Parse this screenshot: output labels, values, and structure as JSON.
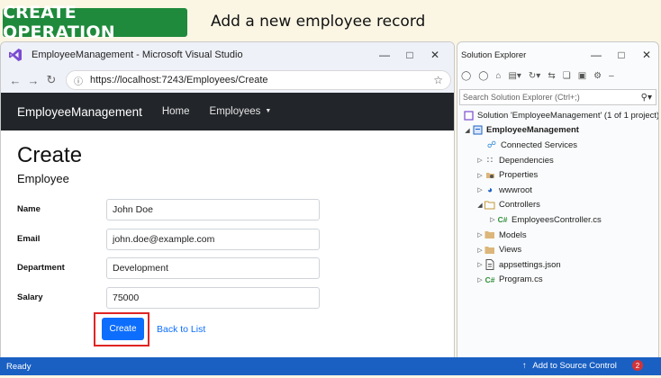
{
  "banner": {
    "badge": "CREATE OPERATION",
    "subtitle": "Add a new employee record"
  },
  "browser": {
    "title": "EmployeeManagement - Microsoft Visual Studio",
    "url": "https://localhost:7243/Employees/Create"
  },
  "app": {
    "brand": "EmployeeManagement",
    "nav": {
      "home": "Home",
      "employees": "Employees"
    }
  },
  "page": {
    "heading": "Create",
    "entity": "Employee",
    "fields": [
      {
        "label": "Name",
        "value": "John Doe"
      },
      {
        "label": "Email",
        "value": "john.doe@example.com"
      },
      {
        "label": "Department",
        "value": "Development"
      },
      {
        "label": "Salary",
        "value": "75000"
      }
    ],
    "create_button": "Create",
    "back_link": "Back to List"
  },
  "solution_explorer": {
    "title": "Solution Explorer",
    "search_placeholder": "Search Solution Explorer (Ctrl+;)",
    "tree": [
      {
        "label": "Solution 'EmployeeManagement' (1 of 1 project)",
        "icon": "solution-icon"
      },
      {
        "label": "EmployeeManagement",
        "icon": "project-icon"
      },
      {
        "label": "Connected Services",
        "icon": "connected-services-icon"
      },
      {
        "label": "Dependencies",
        "icon": "dependencies-icon"
      },
      {
        "label": "Properties",
        "icon": "properties-icon"
      },
      {
        "label": "wwwroot",
        "icon": "globe-icon"
      },
      {
        "label": "Controllers",
        "icon": "folder-icon"
      },
      {
        "label": "EmployeesController.cs",
        "icon": "csharp-file-icon"
      },
      {
        "label": "Models",
        "icon": "folder-icon"
      },
      {
        "label": "Views",
        "icon": "folder-icon"
      },
      {
        "label": "appsettings.json",
        "icon": "json-file-icon"
      },
      {
        "label": "Program.cs",
        "icon": "csharp-file-icon"
      }
    ]
  },
  "statusbar": {
    "left": "Ready",
    "source_control": "Add to Source Control",
    "notification_count": "2"
  },
  "colors": {
    "badge": "#1f8a3c",
    "navbar": "#222529",
    "primary": "#0d6efd",
    "highlight": "#e02424",
    "statusbar": "#1a60c3"
  }
}
